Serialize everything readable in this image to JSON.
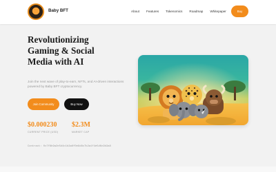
{
  "nav": {
    "brand": "Baby BFT",
    "links": [
      "About",
      "Features",
      "Tokenomics",
      "Roadmap",
      "Whitepaper"
    ],
    "buy_label": "Buy"
  },
  "hero": {
    "title": "Revolutionizing\nGaming & Social\nMedia with AI",
    "subtitle": "Join the next wave of play-to-earn, NFTs, and AI-driven interactions\npowered by Baby BFT cryptocurrency.",
    "primary_cta": "Join Community",
    "secondary_cta": "Buy Now"
  },
  "stats": {
    "price_value": "$0.000230",
    "price_label": "Current Price (USD)",
    "mcap_value": "$2.3M",
    "mcap_label": "Market Cap"
  },
  "contract": {
    "text": "Contract: 0x7f8b9a2e5d4c1b3a6f0e9d8c7b2a1f4e5d6c9b3a8"
  },
  "colors": {
    "accent": "#f28c1c",
    "dark_button": "#111111",
    "background": "#f2f2f2"
  },
  "icons": {
    "logo": "baby-bft-logo-icon"
  }
}
